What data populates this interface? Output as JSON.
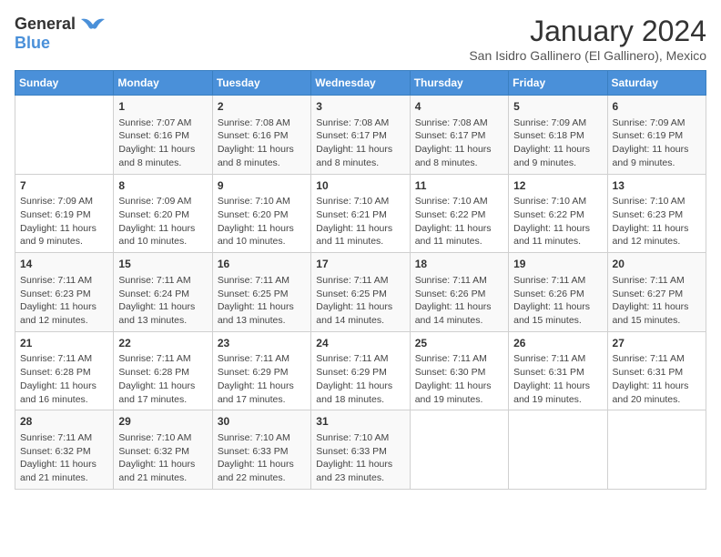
{
  "logo": {
    "general": "General",
    "blue": "Blue"
  },
  "title": "January 2024",
  "location": "San Isidro Gallinero (El Gallinero), Mexico",
  "days_of_week": [
    "Sunday",
    "Monday",
    "Tuesday",
    "Wednesday",
    "Thursday",
    "Friday",
    "Saturday"
  ],
  "weeks": [
    [
      {
        "day": "",
        "info": ""
      },
      {
        "day": "1",
        "info": "Sunrise: 7:07 AM\nSunset: 6:16 PM\nDaylight: 11 hours\nand 8 minutes."
      },
      {
        "day": "2",
        "info": "Sunrise: 7:08 AM\nSunset: 6:16 PM\nDaylight: 11 hours\nand 8 minutes."
      },
      {
        "day": "3",
        "info": "Sunrise: 7:08 AM\nSunset: 6:17 PM\nDaylight: 11 hours\nand 8 minutes."
      },
      {
        "day": "4",
        "info": "Sunrise: 7:08 AM\nSunset: 6:17 PM\nDaylight: 11 hours\nand 8 minutes."
      },
      {
        "day": "5",
        "info": "Sunrise: 7:09 AM\nSunset: 6:18 PM\nDaylight: 11 hours\nand 9 minutes."
      },
      {
        "day": "6",
        "info": "Sunrise: 7:09 AM\nSunset: 6:19 PM\nDaylight: 11 hours\nand 9 minutes."
      }
    ],
    [
      {
        "day": "7",
        "info": "Sunrise: 7:09 AM\nSunset: 6:19 PM\nDaylight: 11 hours\nand 9 minutes."
      },
      {
        "day": "8",
        "info": "Sunrise: 7:09 AM\nSunset: 6:20 PM\nDaylight: 11 hours\nand 10 minutes."
      },
      {
        "day": "9",
        "info": "Sunrise: 7:10 AM\nSunset: 6:20 PM\nDaylight: 11 hours\nand 10 minutes."
      },
      {
        "day": "10",
        "info": "Sunrise: 7:10 AM\nSunset: 6:21 PM\nDaylight: 11 hours\nand 11 minutes."
      },
      {
        "day": "11",
        "info": "Sunrise: 7:10 AM\nSunset: 6:22 PM\nDaylight: 11 hours\nand 11 minutes."
      },
      {
        "day": "12",
        "info": "Sunrise: 7:10 AM\nSunset: 6:22 PM\nDaylight: 11 hours\nand 11 minutes."
      },
      {
        "day": "13",
        "info": "Sunrise: 7:10 AM\nSunset: 6:23 PM\nDaylight: 11 hours\nand 12 minutes."
      }
    ],
    [
      {
        "day": "14",
        "info": "Sunrise: 7:11 AM\nSunset: 6:23 PM\nDaylight: 11 hours\nand 12 minutes."
      },
      {
        "day": "15",
        "info": "Sunrise: 7:11 AM\nSunset: 6:24 PM\nDaylight: 11 hours\nand 13 minutes."
      },
      {
        "day": "16",
        "info": "Sunrise: 7:11 AM\nSunset: 6:25 PM\nDaylight: 11 hours\nand 13 minutes."
      },
      {
        "day": "17",
        "info": "Sunrise: 7:11 AM\nSunset: 6:25 PM\nDaylight: 11 hours\nand 14 minutes."
      },
      {
        "day": "18",
        "info": "Sunrise: 7:11 AM\nSunset: 6:26 PM\nDaylight: 11 hours\nand 14 minutes."
      },
      {
        "day": "19",
        "info": "Sunrise: 7:11 AM\nSunset: 6:26 PM\nDaylight: 11 hours\nand 15 minutes."
      },
      {
        "day": "20",
        "info": "Sunrise: 7:11 AM\nSunset: 6:27 PM\nDaylight: 11 hours\nand 15 minutes."
      }
    ],
    [
      {
        "day": "21",
        "info": "Sunrise: 7:11 AM\nSunset: 6:28 PM\nDaylight: 11 hours\nand 16 minutes."
      },
      {
        "day": "22",
        "info": "Sunrise: 7:11 AM\nSunset: 6:28 PM\nDaylight: 11 hours\nand 17 minutes."
      },
      {
        "day": "23",
        "info": "Sunrise: 7:11 AM\nSunset: 6:29 PM\nDaylight: 11 hours\nand 17 minutes."
      },
      {
        "day": "24",
        "info": "Sunrise: 7:11 AM\nSunset: 6:29 PM\nDaylight: 11 hours\nand 18 minutes."
      },
      {
        "day": "25",
        "info": "Sunrise: 7:11 AM\nSunset: 6:30 PM\nDaylight: 11 hours\nand 19 minutes."
      },
      {
        "day": "26",
        "info": "Sunrise: 7:11 AM\nSunset: 6:31 PM\nDaylight: 11 hours\nand 19 minutes."
      },
      {
        "day": "27",
        "info": "Sunrise: 7:11 AM\nSunset: 6:31 PM\nDaylight: 11 hours\nand 20 minutes."
      }
    ],
    [
      {
        "day": "28",
        "info": "Sunrise: 7:11 AM\nSunset: 6:32 PM\nDaylight: 11 hours\nand 21 minutes."
      },
      {
        "day": "29",
        "info": "Sunrise: 7:10 AM\nSunset: 6:32 PM\nDaylight: 11 hours\nand 21 minutes."
      },
      {
        "day": "30",
        "info": "Sunrise: 7:10 AM\nSunset: 6:33 PM\nDaylight: 11 hours\nand 22 minutes."
      },
      {
        "day": "31",
        "info": "Sunrise: 7:10 AM\nSunset: 6:33 PM\nDaylight: 11 hours\nand 23 minutes."
      },
      {
        "day": "",
        "info": ""
      },
      {
        "day": "",
        "info": ""
      },
      {
        "day": "",
        "info": ""
      }
    ]
  ]
}
